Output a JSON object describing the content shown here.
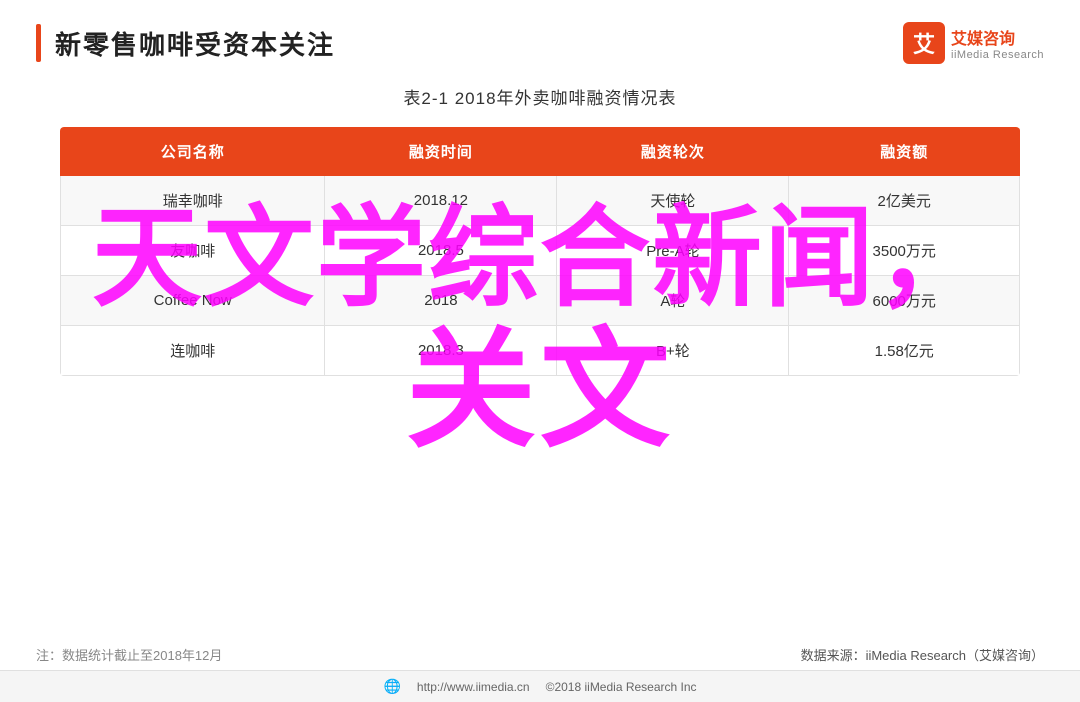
{
  "header": {
    "title": "新零售咖啡受资本关注",
    "logo": {
      "icon_text": "艾",
      "logo_cn": "艾媒咨询",
      "logo_en": "iiMedia Research"
    }
  },
  "table": {
    "title": "表2-1 2018年外卖咖啡融资情况表",
    "columns": [
      "公司名称",
      "融资时间",
      "融资轮次",
      "融资额"
    ],
    "rows": [
      {
        "company": "瑞幸咖啡",
        "time": "2018.12",
        "round": "天使轮",
        "amount": "2亿美元"
      },
      {
        "company": "友咖啡",
        "time": "2018.5",
        "round": "Pre-A轮",
        "amount": "3500万元"
      },
      {
        "company": "Coffee Now",
        "time": "2018",
        "round": "A轮",
        "amount": "6000万元"
      },
      {
        "company": "连咖啡",
        "time": "2018.3",
        "round": "B+轮",
        "amount": "1.58亿元"
      }
    ]
  },
  "watermark": {
    "line1": "天文学综合新闻，",
    "line2": "关文"
  },
  "footer": {
    "note_left": "注：数据统计截止至2018年12月",
    "note_right": "数据来源：iiMedia Research（艾媒咨询）",
    "url": "http://www.iimedia.cn",
    "copyright": "©2018  iiMedia Research Inc"
  }
}
